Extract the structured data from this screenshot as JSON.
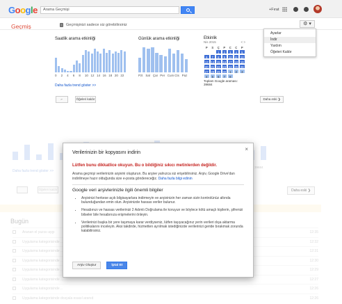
{
  "topbar": {
    "logo_letters": [
      "G",
      "o",
      "o",
      "g",
      "l",
      "e"
    ],
    "search_value": "Arama Geçmişi",
    "user": "+Fırat"
  },
  "header": {
    "title": "Geçmiş",
    "private_note": "Geçmişinizi sadece siz görebilirsiniz",
    "gear_label": "⚙ ▾"
  },
  "settings_menu": {
    "items": [
      "Ayarlar",
      "İndir",
      "Yardım",
      "Öğeleri Kaldır"
    ]
  },
  "hourly": {
    "title": "Saatlik arama etkinliği",
    "ticks": [
      "0",
      "2",
      "4",
      "6",
      "8",
      "10",
      "12",
      "14",
      "16",
      "18",
      "20",
      "22"
    ],
    "values": [
      0.55,
      0.25,
      0.15,
      0.1,
      0.05,
      0.05,
      0.3,
      0.45,
      0.35,
      0.65,
      0.85,
      0.8,
      0.7,
      0.9,
      0.8,
      0.7,
      0.9,
      0.75,
      0.85,
      0.7,
      0.8,
      0.75,
      0.85,
      0.8
    ]
  },
  "daily": {
    "title": "Günlük arama etkinliği",
    "ticks": [
      "Pzt",
      "Sal",
      "Çar",
      "Per",
      "Cum",
      "Cts",
      "Paz"
    ],
    "values": [
      0.55,
      0.95,
      0.9,
      0.95,
      0.75,
      0.65,
      0.6,
      0.9,
      0.7,
      0.85,
      0.7,
      0.5
    ]
  },
  "activity": {
    "title": "Etkinlik",
    "month": "Nis 2015",
    "arrows": "< >",
    "weekday_headers": [
      "P",
      "S",
      "Ç",
      "P",
      "C",
      "C",
      "P"
    ],
    "days": [
      "",
      "",
      "1",
      "2",
      "3",
      "4",
      "5",
      "6",
      "7",
      "8",
      "9",
      "10",
      "11",
      "12",
      "13",
      "14",
      "15",
      "16",
      "17",
      "18",
      "19",
      "20",
      "21",
      "22",
      "23",
      "24",
      "25",
      "26",
      "27",
      "28",
      "29",
      "30",
      "1",
      "2",
      "3",
      "4",
      "5",
      "6",
      "7",
      "8"
    ],
    "total": "Toplam Google araması: 39684"
  },
  "more_trends": "Daha fazla trend göster >>",
  "actions": {
    "select_label": "⌐",
    "remove_label": "Öğeleri kaldır",
    "older_label": "Daha eski ❯"
  },
  "background": {
    "more_trends": "Daha fazla trend göster >>",
    "total_fragment": "39684",
    "remove_label": "Öğeleri kaldır",
    "older_label": "Daha eski ❯",
    "today": "Bugün",
    "rows": [
      {
        "text": "Aranan el yazısı aygı",
        "time": "12:35"
      },
      {
        "text": "Uygulama kategorisinde ...",
        "time": "12:32"
      },
      {
        "text": "Uygulama kategorisinde ...",
        "time": "12:31"
      },
      {
        "text": "Uygulama kategorisinde ...",
        "time": "12:30"
      },
      {
        "text": "Uygulama kategorisinde ...",
        "time": "12:29"
      },
      {
        "text": "Uygulama kategorisinde ...",
        "time": "12:27"
      },
      {
        "text": "Uygulama kategorisinde ..",
        "time": "12:26"
      },
      {
        "text": "Uygulama kategorisinde dosyala esasıl aranıd",
        "time": "12:26"
      }
    ]
  },
  "modal": {
    "close": "×",
    "title": "Verilerinizin bir kopyasını indirin",
    "warning": "Lütfen bunu dikkatlice okuyun. Bu o bildiğiniz sıkıcı metinlerden değildir.",
    "intro": "Arama geçmişi verilerinizin arşivini oluşturun. Bu arşive yalnızca siz erişebilirsiniz. Arşiv, Google Drive'dan indirilmeye hazır olduğunda size e-posta göndereceğiz.",
    "intro_link": "Daha fazla bilgi edinin",
    "subtitle": "Google veri arşivlerinizle ilgili önemli bilgiler",
    "bullets": [
      "Arşivinizi herkese açık bilgisayarlara indirmeyin ve arşivinizin her zaman sizin kontrolünüz altında bulunduğundan emin olun. Arşivinizde hassas veriler bulunur.",
      "Hesabınızı ve hassas verilerinizi 2 Adımlı Doğrulama ile koruyun ve böylece kötü amaçlı kişilerin, şifrenizi bilseler bile hesabınıza erişmelerini önleyin.",
      "Verilerinizi başka bir yere taşımaya karar verdiyseniz, lütfen taşıyacağınız yerin verileri dışa aktarma politikalarını inceleyin. Aksi takdirde, hizmetten ayrılmak istediğinizde verilerinizi geride bırakmak zorunda kalabilirsiniz."
    ],
    "bullet2_link": "2 Adımlı Doğrulama",
    "create_button": "Arşiv Oluştur",
    "cancel_button": "İptal Et"
  }
}
